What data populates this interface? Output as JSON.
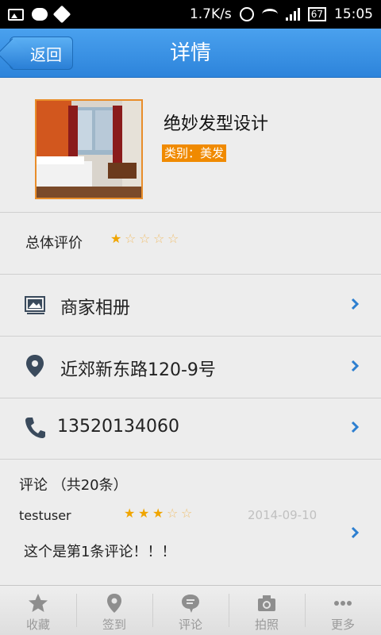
{
  "status_bar": {
    "speed": "1.7K/s",
    "battery": "67",
    "time": "15:05"
  },
  "header": {
    "back_label": "返回",
    "title": "详情"
  },
  "shop": {
    "name": "绝妙发型设计",
    "category": "类别：美发"
  },
  "rating": {
    "label": "总体评价",
    "stars": 1,
    "max": 5
  },
  "rows": {
    "album": "商家相册",
    "address": "近郊新东路120-9号",
    "phone": "13520134060"
  },
  "comments": {
    "title": "评论 （共20条）",
    "items": [
      {
        "user": "testuser",
        "stars": 3,
        "max": 5,
        "date": "2014-09-10",
        "text": "这个是第1条评论！！！"
      }
    ]
  },
  "tabs": [
    {
      "label": "收藏",
      "icon": "star-icon"
    },
    {
      "label": "签到",
      "icon": "location-pin-icon"
    },
    {
      "label": "评论",
      "icon": "comment-icon"
    },
    {
      "label": "拍照",
      "icon": "camera-icon"
    },
    {
      "label": "更多",
      "icon": "more-icon"
    }
  ],
  "colors": {
    "header": "#2d84db",
    "accent_orange": "#f08a00",
    "star": "#f0a500",
    "chevron": "#2d7fd0"
  }
}
